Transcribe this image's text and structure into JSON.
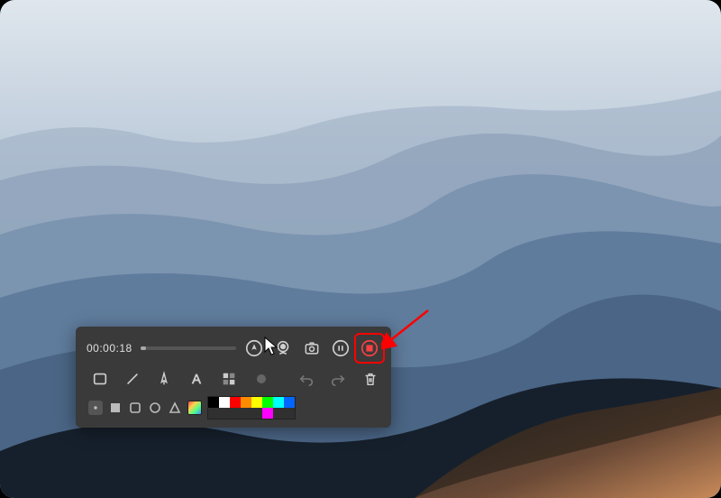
{
  "timer": "00:00:18",
  "palette": {
    "row1": [
      "#000000",
      "#ffffff",
      "#ff0000",
      "#ff8c00",
      "#ffff00",
      "#00ff00",
      "#00ffff",
      "#0066ff"
    ],
    "row2": [
      "#303030",
      "#303030",
      "#303030",
      "#303030",
      "#303030",
      "#ff00ff",
      "#303030",
      "#303030"
    ]
  },
  "icons": {
    "marker": "marker-icon",
    "webcam": "webcam-icon",
    "screenshot": "screenshot-icon",
    "pause": "pause-icon",
    "stop": "stop-icon",
    "rectangle": "rectangle-icon",
    "line": "line-icon",
    "pen": "pen-icon",
    "text": "text-icon",
    "mosaic": "mosaic-icon",
    "brush": "brush-icon",
    "undo": "undo-icon",
    "redo": "redo-icon",
    "trash": "trash-icon"
  }
}
